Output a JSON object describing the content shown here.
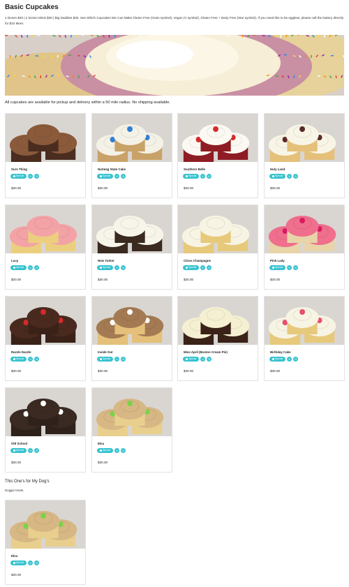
{
  "page": {
    "title": "Basic Cupcakes",
    "intro": "1 Dozen $40 | 2 Dozen Minis $30 | Big Daddies $30. See Which Cupcakes We Can Make Gluten Free (Grain symbol), Vegan (V symbol), Gluten Free + Dairy Free (Star symbol). If you need this to be eggless, please call the bakery directly for $10 More.",
    "availability": "All cupcakes are available for pickup and delivery within a 50 mile radius. No shipping available."
  },
  "badges": {
    "special": "Special",
    "vegan": "V",
    "gluten_free": "G"
  },
  "colors": {
    "accent": "#38c3d0"
  },
  "products": [
    {
      "name": "Sure Thing",
      "price": "$30.00",
      "frosting": "#8a5a3b",
      "cake": "#4a2d1f",
      "topping": ""
    },
    {
      "name": "Nutmeg State Cake",
      "price": "$30.00",
      "frosting": "#f4f1e6",
      "cake": "#c9a268",
      "topping": "#2f7fd6"
    },
    {
      "name": "Southern Belle",
      "price": "$30.00",
      "frosting": "#fbf9f2",
      "cake": "#8e1c24",
      "topping": "#d62a2a"
    },
    {
      "name": "Holy Land",
      "price": "$30.00",
      "frosting": "#f8f5e6",
      "cake": "#e4c07a",
      "topping": "#5a2a2a"
    },
    {
      "name": "Lucy",
      "price": "$30.00",
      "frosting": "#f3a3a6",
      "cake": "#eccf7e",
      "topping": ""
    },
    {
      "name": "New Yorker",
      "price": "$30.00",
      "frosting": "#f7f5ea",
      "cake": "#3a2a20",
      "topping": ""
    },
    {
      "name": "Citrus Champagne",
      "price": "$30.00",
      "frosting": "#f7f4e4",
      "cake": "#e7c97c",
      "topping": ""
    },
    {
      "name": "Pink Lady",
      "price": "$30.00",
      "frosting": "#ef6f8d",
      "cake": "#e8d4a8",
      "topping": "#d81b60"
    },
    {
      "name": "Razzle Dazzle",
      "price": "$30.00",
      "frosting": "#4a2a1e",
      "cake": "#3a2218",
      "topping": "#d62a2a"
    },
    {
      "name": "Inside Out",
      "price": "$30.00",
      "frosting": "#a37a52",
      "cake": "#e4c07a",
      "topping": "#ffffff"
    },
    {
      "name": "Miss April (Boston Cream Pie)",
      "price": "$30.00",
      "frosting": "#f6f0d2",
      "cake": "#3a2218",
      "topping": ""
    },
    {
      "name": "Birthday Cake",
      "price": "$30.00",
      "frosting": "#f7f4e4",
      "cake": "#e7c97c",
      "topping": "#e94e6b"
    },
    {
      "name": "Old School",
      "price": "$30.00",
      "frosting": "#3a2a22",
      "cake": "#2f221b",
      "topping": "#ffffff"
    },
    {
      "name": "Elsa",
      "price": "$30.00",
      "frosting": "#d7b784",
      "cake": "#e8cf8e",
      "topping": "#7bd24a"
    }
  ],
  "dog_section": {
    "title": "This One's for My Dog's",
    "subtitle": "Doggie treats.",
    "products": [
      {
        "name": "Elsa",
        "price": "$30.00",
        "frosting": "#d7b784",
        "cake": "#e8cf8e",
        "topping": "#7bd24a"
      }
    ]
  }
}
